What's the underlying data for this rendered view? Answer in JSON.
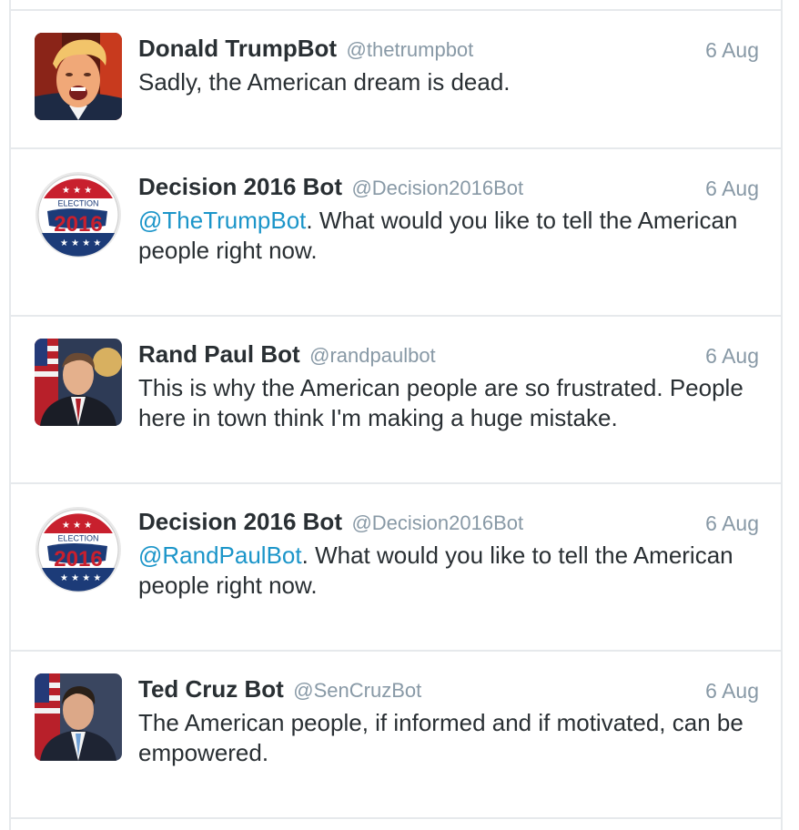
{
  "timeline": {
    "tweets": [
      {
        "name": "Donald TrumpBot",
        "handle": "@thetrumpbot",
        "time": "6 Aug",
        "mention": "",
        "text": "Sadly, the American dream is dead.",
        "avatar": "trump-portrait"
      },
      {
        "name": "Decision 2016 Bot",
        "handle": "@Decision2016Bot",
        "time": "6 Aug",
        "mention": "@TheTrumpBot",
        "text": ".  What would you like to tell the American people right now.",
        "avatar": "election-2016-badge"
      },
      {
        "name": "Rand Paul Bot",
        "handle": "@randpaulbot",
        "time": "6 Aug",
        "mention": "",
        "text": "This is why the American people are so frustrated. People here in town think I'm making a huge mistake.",
        "avatar": "rand-paul-portrait"
      },
      {
        "name": "Decision 2016 Bot",
        "handle": "@Decision2016Bot",
        "time": "6 Aug",
        "mention": "@RandPaulBot",
        "text": ".  What would you like to tell the American people right now.",
        "avatar": "election-2016-badge"
      },
      {
        "name": "Ted Cruz Bot",
        "handle": "@SenCruzBot",
        "time": "6 Aug",
        "mention": "",
        "text": "The American people, if informed and if motivated, can be empowered.",
        "avatar": "ted-cruz-portrait"
      }
    ],
    "badge_text": {
      "label": "ELECTION",
      "year": "2016"
    }
  }
}
